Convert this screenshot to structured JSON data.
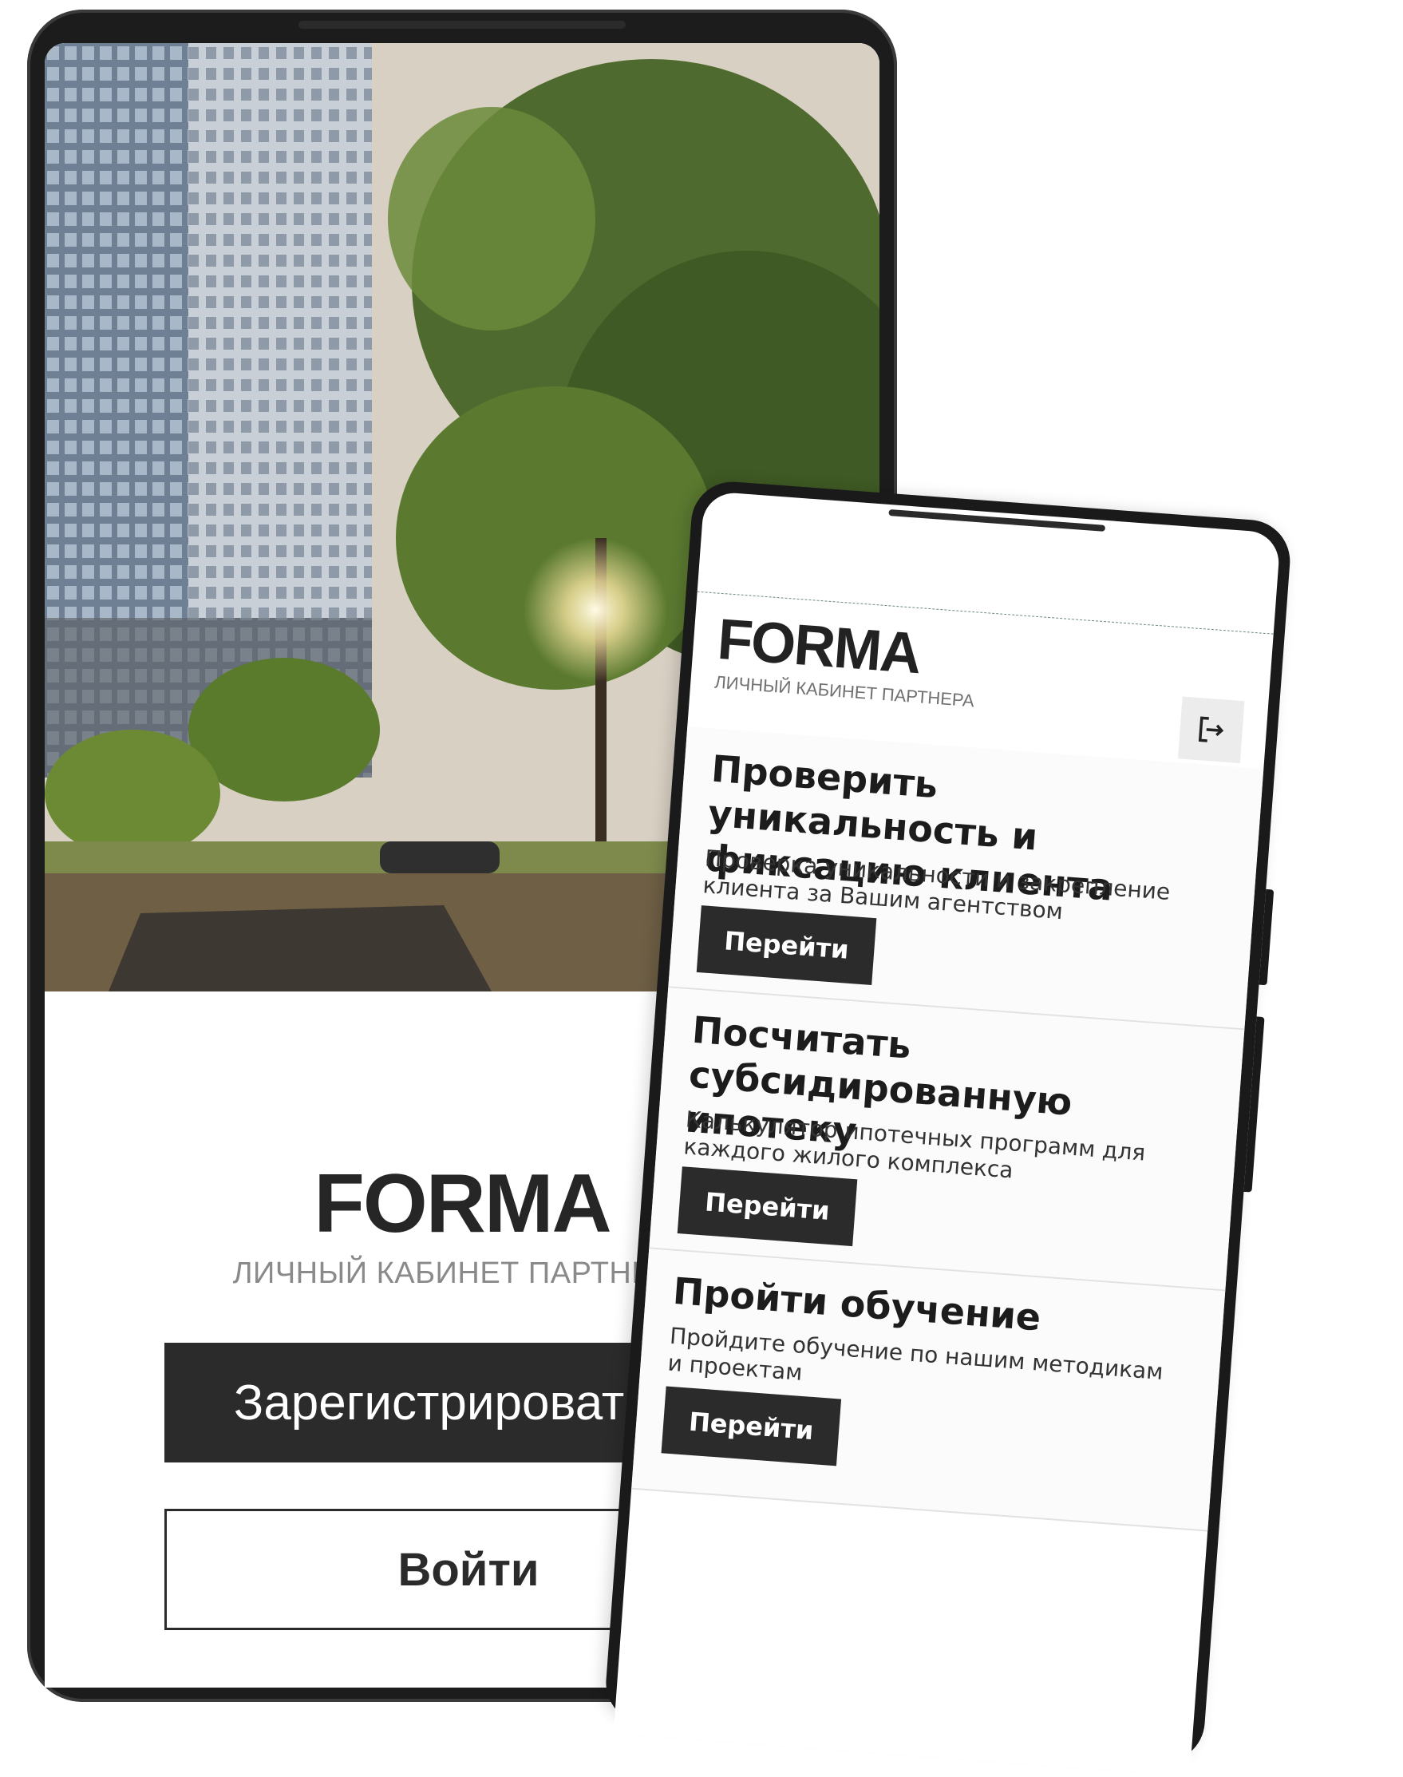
{
  "login_screen": {
    "brand": "FORMA",
    "subtitle": "ЛИЧНЫЙ КАБИНЕТ ПАРТНЕРА",
    "register_label": "Зарегистрироваться",
    "login_label": "Войти"
  },
  "dashboard": {
    "brand": "FORMA",
    "subtitle": "ЛИЧНЫЙ КАБИНЕТ ПАРТНЕРА",
    "exit_icon": "logout-icon",
    "cards": [
      {
        "title": "Проверить уникальность и фиксацию клиента",
        "description": "Проверка уникальности и закрепление клиента за Вашим агентством",
        "button": "Перейти"
      },
      {
        "title": "Посчитать субсидированную ипотеку",
        "description": "Калькулятор ипотечных программ для каждого жилого комплекса",
        "button": "Перейти"
      },
      {
        "title": "Пройти обучение",
        "description": "Пройдите обучение по нашим методикам и проектам",
        "button": "Перейти"
      }
    ]
  },
  "colors": {
    "dark_button": "#2b2b2b",
    "frame": "#1c1c1c",
    "muted_text": "#8a8a8a"
  }
}
